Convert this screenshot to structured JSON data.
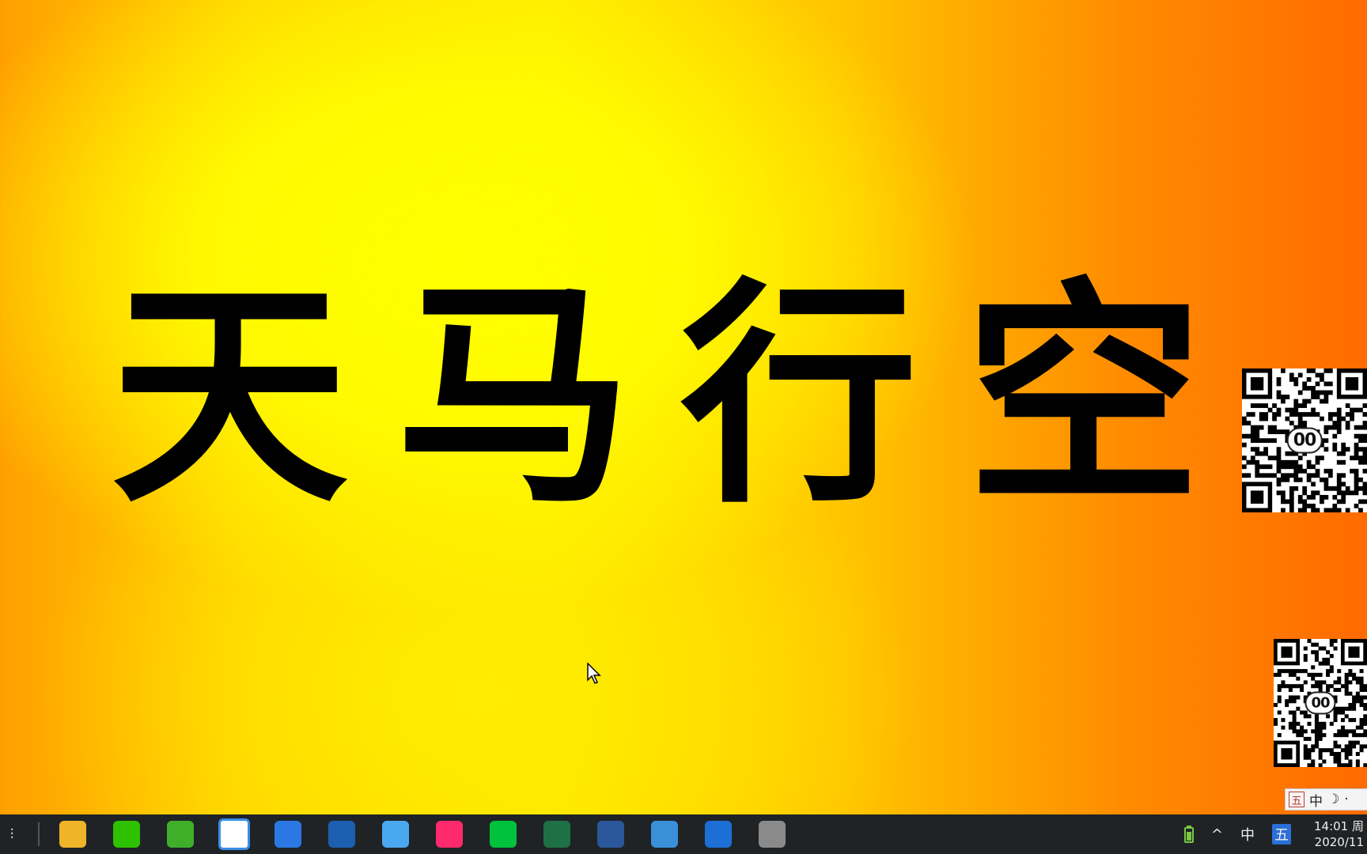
{
  "wallpaper": {
    "chars": [
      "天",
      "马",
      "行",
      "空"
    ]
  },
  "qr_codes": [
    {
      "label": "00"
    },
    {
      "label": "00"
    }
  ],
  "ime": {
    "box": "五",
    "mode": "中",
    "moon": "☽",
    "dot": "·"
  },
  "taskbar": {
    "left_glyph": "⫶",
    "apps": [
      {
        "name": "file-explorer",
        "color": "#f0b429"
      },
      {
        "name": "wechat",
        "color": "#2dc100"
      },
      {
        "name": "browser",
        "color": "#3fae29"
      },
      {
        "name": "baidu-netdisk",
        "color": "#ffffff"
      },
      {
        "name": "contacts",
        "color": "#2b78e4"
      },
      {
        "name": "media-player",
        "color": "#1c5fb0"
      },
      {
        "name": "chat-app",
        "color": "#4aa8f0"
      },
      {
        "name": "video-app",
        "color": "#ff2a6d"
      },
      {
        "name": "iqiyi",
        "color": "#00c13b"
      },
      {
        "name": "excel",
        "color": "#1e7145"
      },
      {
        "name": "word",
        "color": "#2b579a"
      },
      {
        "name": "snipping-tool",
        "color": "#3b8fd9"
      },
      {
        "name": "screen-recorder",
        "color": "#1d6fd6"
      },
      {
        "name": "microphone",
        "color": "#8a8a8a"
      }
    ],
    "tray": {
      "chevron": "^",
      "lang": "中",
      "ime": "五",
      "time": "14:01 周",
      "date": "2020/11"
    }
  }
}
